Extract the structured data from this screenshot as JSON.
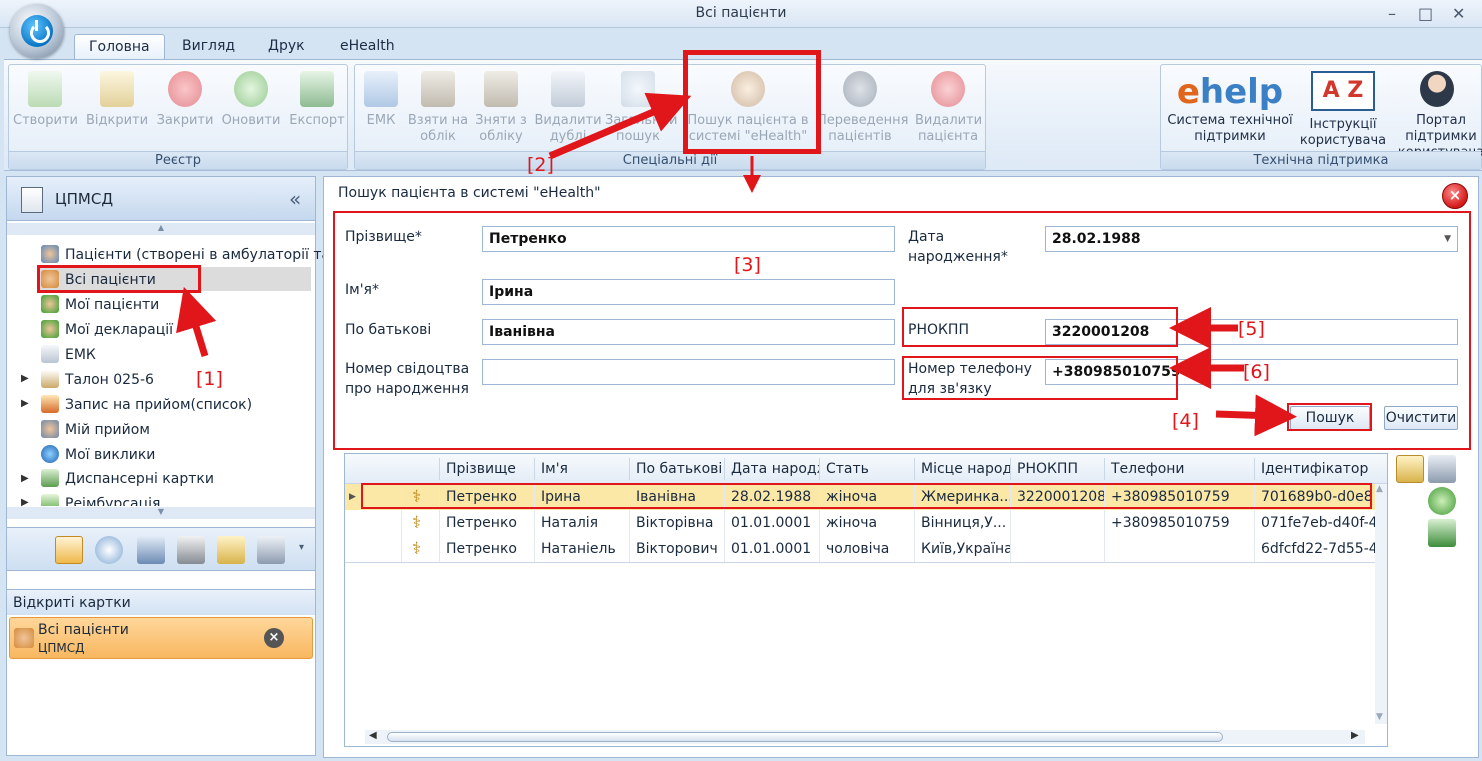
{
  "window": {
    "title": "Всі пацієнти",
    "controls": [
      "–",
      "□",
      "✕"
    ]
  },
  "tabs": [
    {
      "label": "Головна",
      "active": true
    },
    {
      "label": "Вигляд",
      "active": false
    },
    {
      "label": "Друк",
      "active": false
    },
    {
      "label": "eHealth",
      "active": false
    }
  ],
  "ribbon": {
    "registry": {
      "label": "Реєстр",
      "buttons": [
        {
          "label": "Створити",
          "icon": "create-icon"
        },
        {
          "label": "Відкрити",
          "icon": "open-icon"
        },
        {
          "label": "Закрити",
          "icon": "close-icon"
        },
        {
          "label": "Оновити",
          "icon": "refresh-icon"
        },
        {
          "label": "Експорт",
          "icon": "export-icon"
        }
      ]
    },
    "special": {
      "label": "Спеціальні дії",
      "buttons": [
        {
          "label": "ЕМК",
          "icon": "emk-icon"
        },
        {
          "label": "Взяти на облік",
          "icon": "take-account-icon"
        },
        {
          "label": "Зняти з обліку",
          "icon": "remove-account-icon"
        },
        {
          "label": "Видалити дублі",
          "icon": "delete-duplicates-icon"
        },
        {
          "label": "Загальний пошук",
          "icon": "general-search-icon"
        },
        {
          "label": "Пошук пацієнта в системі \"eHealth\"",
          "icon": "ehealth-search-icon"
        },
        {
          "label": "Переведення пацієнтів",
          "icon": "transfer-patients-icon"
        },
        {
          "label": "Видалити пацієнта",
          "icon": "delete-patient-icon"
        }
      ]
    },
    "support": {
      "label": "Технічна підтримка",
      "buttons": [
        {
          "label": "Система технічної підтримки",
          "icon": "ehelp-icon"
        },
        {
          "label": "Інструкції користувача",
          "icon": "az-instructions-icon"
        },
        {
          "label": "Портал підтримки користувача",
          "icon": "support-portal-icon"
        }
      ]
    }
  },
  "ehelp_logo": {
    "e": "e",
    "rest": "help"
  },
  "az_logo": {
    "a": "A",
    "z": "Z"
  },
  "nav": {
    "title": "ЦПМСД",
    "items": [
      {
        "label": "Пацієнти (створені в амбулаторії та",
        "icon": "patients-created-icon",
        "expander": false
      },
      {
        "label": "Всі пацієнти",
        "icon": "all-patients-icon",
        "expander": false,
        "selected": true
      },
      {
        "label": "Мої пацієнти",
        "icon": "my-patients-icon",
        "expander": false
      },
      {
        "label": "Мої декларації",
        "icon": "my-declarations-icon",
        "expander": false
      },
      {
        "label": "ЕМК",
        "icon": "emk-doc-icon",
        "expander": false
      },
      {
        "label": "Талон 025-6",
        "icon": "talon-icon",
        "expander": true
      },
      {
        "label": "Запис на прийом(список)",
        "icon": "appointment-list-icon",
        "expander": true
      },
      {
        "label": "Мій прийом",
        "icon": "my-reception-icon",
        "expander": false
      },
      {
        "label": "Мої виклики",
        "icon": "my-calls-icon",
        "expander": false
      },
      {
        "label": "Диспансерні картки",
        "icon": "dispensary-cards-icon",
        "expander": true
      },
      {
        "label": "Реімбурсація",
        "icon": "reimbursement-icon",
        "expander": true
      }
    ],
    "open_cards_label": "Відкриті картки",
    "open_card": {
      "title": "Всі пацієнти",
      "subtitle": "ЦПМСД"
    }
  },
  "search_panel": {
    "title": "Пошук пацієнта в системі \"eHealth\"",
    "fields": {
      "surname": {
        "label": "Прізвище*",
        "value": "Петренко"
      },
      "name": {
        "label": "Ім'я*",
        "value": "Ірина"
      },
      "patronymic": {
        "label": "По батькові",
        "value": "Іванівна"
      },
      "birth_cert": {
        "label_line1": "Номер свідоцтва",
        "label_line2": "про народження",
        "value": ""
      },
      "birth_date": {
        "label_line1": "Дата",
        "label_line2": "народження*",
        "value": "28.02.1988"
      },
      "rnokpp": {
        "label": "РНОКПП",
        "value": "3220001208"
      },
      "phone": {
        "label_line1": "Номер телефону",
        "label_line2": "для зв'язку",
        "value": "+380985010759"
      }
    },
    "search_button": "Пошук",
    "clear_button": "Очистити"
  },
  "grid": {
    "columns": [
      "Прізвище",
      "Ім'я",
      "По батькові",
      "Дата народж",
      "Стать",
      "Місце народ",
      "РНОКПП",
      "Телефони",
      "Ідентифікатор в"
    ],
    "rows": [
      [
        "Петренко",
        "Ірина",
        "Іванівна",
        "28.02.1988",
        "жіноча",
        "Жмеринка...",
        "3220001208",
        "+380985010759",
        "701689b0-d0e8"
      ],
      [
        "Петренко",
        "Наталія",
        "Вікторівна",
        "01.01.0001",
        "жіноча",
        "Вінниця,У...",
        "",
        "+380985010759",
        "071fe7eb-d40f-4"
      ],
      [
        "Петренко",
        "Натаніель",
        "Вікторович",
        "01.01.0001",
        "чоловіча",
        "Київ,Україна",
        "",
        "",
        "6dfcfd22-7d55-4"
      ]
    ]
  },
  "annotations": [
    "[1]",
    "[2]",
    "[3]",
    "[4]",
    "[5]",
    "[6]"
  ],
  "colors": {
    "annotation": "#e0161b",
    "selected_row": "#fbe7a6",
    "open_card": "#f8b760"
  }
}
